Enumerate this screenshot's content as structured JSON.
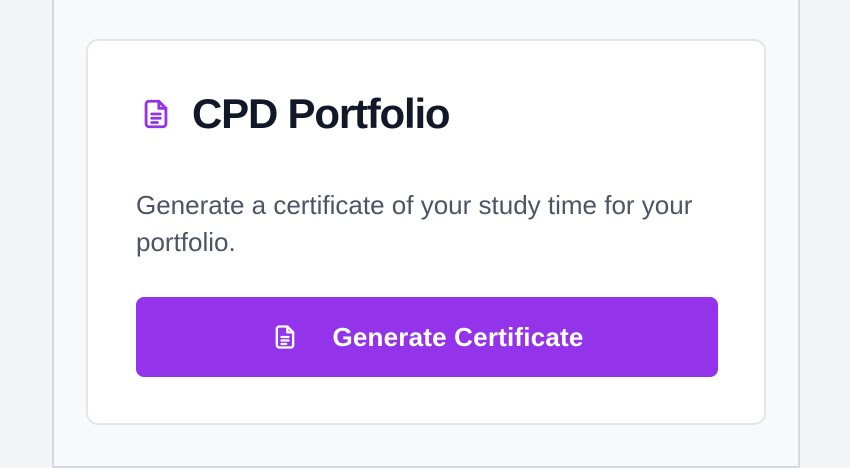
{
  "card": {
    "title": "CPD Portfolio",
    "title_icon": "document-icon",
    "description": "Generate a certificate of your study time for your portfolio.",
    "button": {
      "label": "Generate Certificate",
      "icon": "document-icon"
    }
  },
  "colors": {
    "accent": "#9333ea",
    "title": "#111827",
    "body_text": "#4b5563",
    "card_bg": "#ffffff",
    "page_bg": "#f8f9fb"
  }
}
